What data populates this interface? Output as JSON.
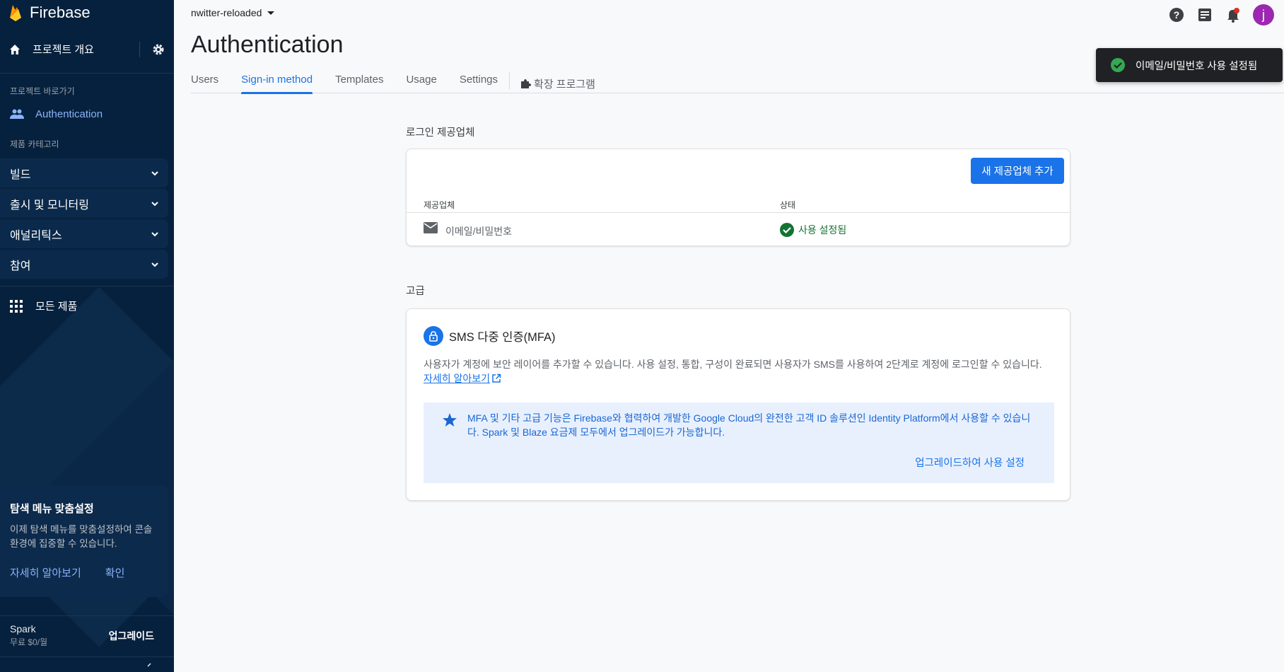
{
  "sidebar": {
    "brand": "Firebase",
    "overview_label": "프로젝트 개요",
    "shortcuts_caption": "프로젝트 바로가기",
    "active_item": "Authentication",
    "categories_caption": "제품 카테고리",
    "groups": [
      {
        "label": "빌드"
      },
      {
        "label": "출시 및 모니터링"
      },
      {
        "label": "애널리틱스"
      },
      {
        "label": "참여"
      }
    ],
    "all_products": "모든 제품",
    "promo": {
      "title": "탐색 메뉴 맞춤설정",
      "body": "이제 탐색 메뉴를 맞춤설정하여 콘솔 환경에 집중할 수 있습니다.",
      "learn_more": "자세히 알아보기",
      "confirm": "확인"
    },
    "plan": {
      "name": "Spark",
      "price": "무료 $0/월",
      "upgrade": "업그레이드"
    }
  },
  "header": {
    "project": "nwitter-reloaded",
    "avatar_letter": "j"
  },
  "page": {
    "title": "Authentication",
    "tabs": [
      {
        "label": "Users"
      },
      {
        "label": "Sign-in method",
        "active": true
      },
      {
        "label": "Templates"
      },
      {
        "label": "Usage"
      },
      {
        "label": "Settings"
      }
    ],
    "extensions_tab": "확장 프로그램"
  },
  "toast": {
    "message": "이메일/비밀번호 사용 설정됨"
  },
  "providers": {
    "section_label": "로그인 제공업체",
    "add_button": "새 제공업체 추가",
    "col_provider": "제공업체",
    "col_status": "상태",
    "rows": [
      {
        "provider": "이메일/비밀번호",
        "status": "사용 설정됨"
      }
    ]
  },
  "advanced": {
    "section_label": "고급",
    "mfa_title": "SMS 다중 인증(MFA)",
    "mfa_desc": "사용자가 계정에 보안 레이어를 추가할 수 있습니다. 사용 설정, 통합, 구성이 완료되면 사용자가 SMS를 사용하여 2단계로 계정에 로그인할 수 있습니다.",
    "learn_more": "자세히 알아보기",
    "banner_text": "MFA 및 기타 고급 기능은 Firebase와 협력하여 개발한 Google Cloud의 완전한 고객 ID 솔루션인 Identity Platform에서 사용할 수 있습니다. Spark 및 Blaze 요금제 모두에서 업그레이드가 가능합니다.",
    "banner_link": "업그레이드하여 사용 설정"
  },
  "colors": {
    "sidebar_bg": "#06213e",
    "accent": "#1a73e8",
    "success": "#137333",
    "avatar": "#9c27b0"
  }
}
